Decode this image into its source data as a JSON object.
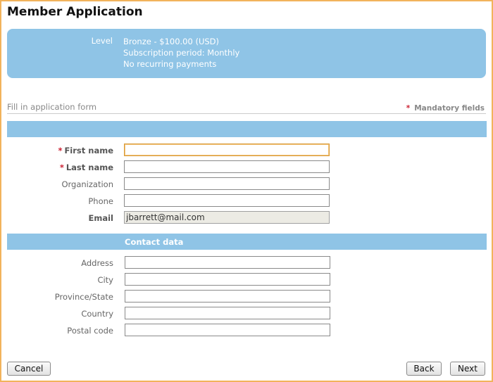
{
  "page": {
    "title": "Member Application"
  },
  "level": {
    "label": "Level",
    "lines": [
      "Bronze - $100.00 (USD)",
      "Subscription period: Monthly",
      "No recurring payments"
    ]
  },
  "form": {
    "intro": "Fill in application form",
    "mandatory_note": "Mandatory fields",
    "personal_fields": [
      {
        "label": "First name",
        "required": true,
        "value": ""
      },
      {
        "label": "Last name",
        "required": true,
        "value": ""
      },
      {
        "label": "Organization",
        "required": false,
        "value": ""
      },
      {
        "label": "Phone",
        "required": false,
        "value": ""
      },
      {
        "label": "Email",
        "required": false,
        "value": "jbarrett@mail.com"
      }
    ],
    "contact_section_title": "Contact data",
    "contact_fields": [
      {
        "label": "Address",
        "value": ""
      },
      {
        "label": "City",
        "value": ""
      },
      {
        "label": "Province/State",
        "value": ""
      },
      {
        "label": "Country",
        "value": ""
      },
      {
        "label": "Postal code",
        "value": ""
      }
    ]
  },
  "buttons": {
    "cancel": "Cancel",
    "back": "Back",
    "next": "Next"
  },
  "colors": {
    "accent": "#8fc4e6",
    "frame": "#f2b35c",
    "required": "#cc2233"
  }
}
